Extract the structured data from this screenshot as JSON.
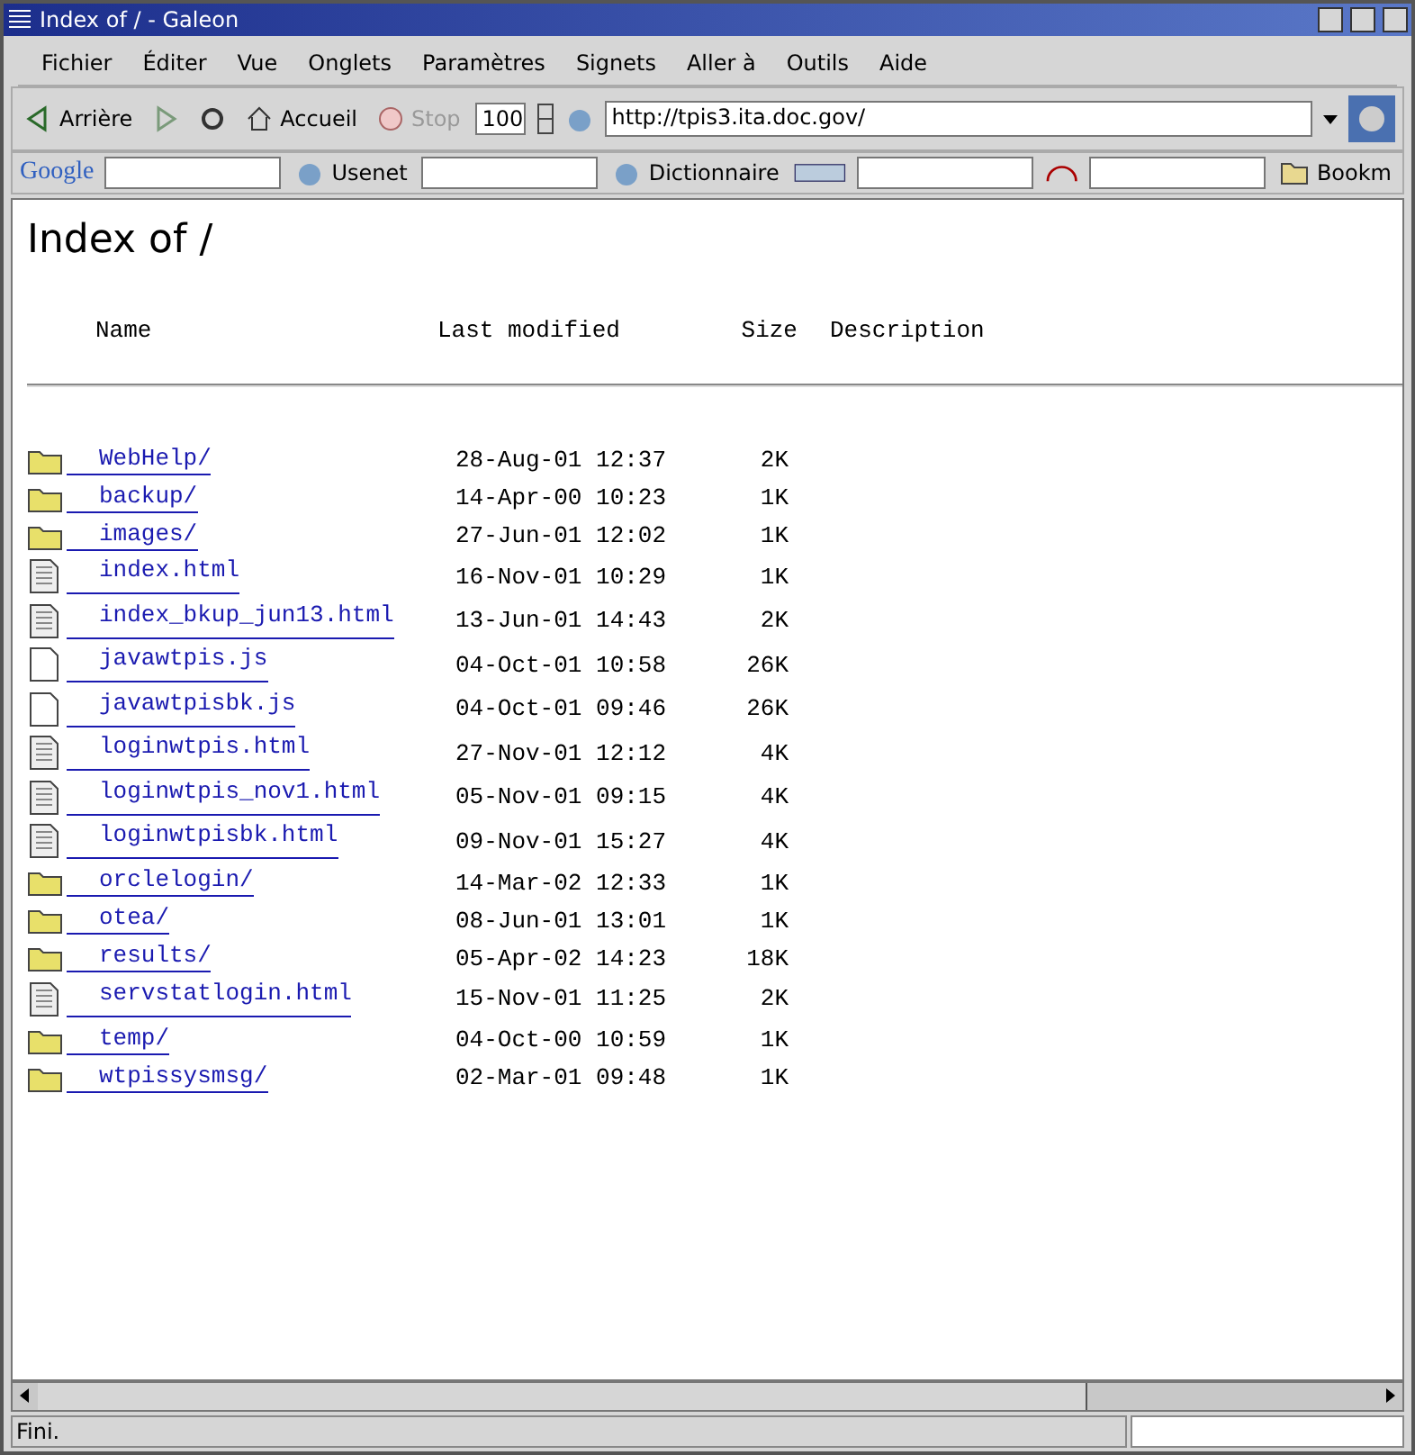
{
  "window": {
    "title": "Index of / - Galeon"
  },
  "menu": [
    "Fichier",
    "Éditer",
    "Vue",
    "Onglets",
    "Paramètres",
    "Signets",
    "Aller à",
    "Outils",
    "Aide"
  ],
  "toolbar": {
    "back": "Arrière",
    "home": "Accueil",
    "stop": "Stop",
    "stop_disabled": true,
    "zoom": "100",
    "url": "http://tpis3.ita.doc.gov/"
  },
  "bookmarks_bar": {
    "google": "Google",
    "usenet": "Usenet",
    "dictionary": "Dictionnaire",
    "folder": "Bookm"
  },
  "page": {
    "heading": "Index of /",
    "columns": [
      "Name",
      "Last modified",
      "Size",
      "Description"
    ],
    "rows": [
      {
        "kind": "folder",
        "name": "WebHelp/",
        "modified": "28-Aug-01 12:37",
        "size": "2K"
      },
      {
        "kind": "folder",
        "name": "backup/",
        "modified": "14-Apr-00 10:23",
        "size": "1K"
      },
      {
        "kind": "folder",
        "name": "images/",
        "modified": "27-Jun-01 12:02",
        "size": "1K"
      },
      {
        "kind": "text",
        "name": "index.html",
        "modified": "16-Nov-01 10:29",
        "size": "1K"
      },
      {
        "kind": "text",
        "name": "index_bkup_jun13.html",
        "modified": "13-Jun-01 14:43",
        "size": "2K"
      },
      {
        "kind": "blank",
        "name": "javawtpis.js",
        "modified": "04-Oct-01 10:58",
        "size": "26K"
      },
      {
        "kind": "blank",
        "name": "javawtpisbk.js",
        "modified": "04-Oct-01 09:46",
        "size": "26K"
      },
      {
        "kind": "text",
        "name": "loginwtpis.html",
        "modified": "27-Nov-01 12:12",
        "size": "4K"
      },
      {
        "kind": "text",
        "name": "loginwtpis_nov1.html",
        "modified": "05-Nov-01 09:15",
        "size": "4K"
      },
      {
        "kind": "text",
        "name": "loginwtpisbk.html",
        "modified": "09-Nov-01 15:27",
        "size": "4K"
      },
      {
        "kind": "folder",
        "name": "orclelogin/",
        "modified": "14-Mar-02 12:33",
        "size": "1K"
      },
      {
        "kind": "folder",
        "name": "otea/",
        "modified": "08-Jun-01 13:01",
        "size": "1K"
      },
      {
        "kind": "folder",
        "name": "results/",
        "modified": "05-Apr-02 14:23",
        "size": "18K"
      },
      {
        "kind": "text",
        "name": "servstatlogin.html",
        "modified": "15-Nov-01 11:25",
        "size": "2K"
      },
      {
        "kind": "folder",
        "name": "temp/",
        "modified": "04-Oct-00 10:59",
        "size": "1K"
      },
      {
        "kind": "folder",
        "name": "wtpissysmsg/",
        "modified": "02-Mar-01 09:48",
        "size": "1K"
      }
    ]
  },
  "status_bar": {
    "text": "Fini."
  }
}
